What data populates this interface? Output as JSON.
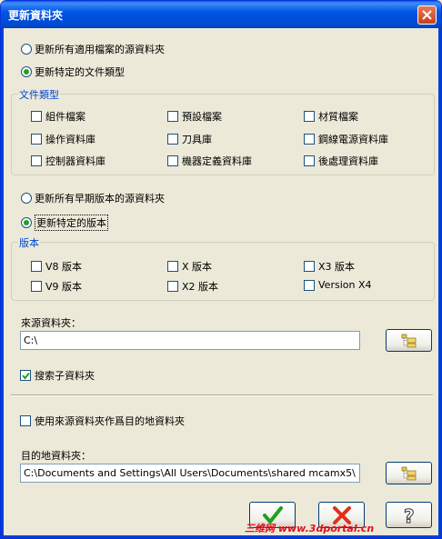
{
  "window": {
    "title": "更新資料夾"
  },
  "source_options": {
    "all_label": "更新所有適用檔案的源資料夾",
    "specific_label": "更新特定的文件類型",
    "selected": "specific"
  },
  "file_types": {
    "group_label": "文件類型",
    "items": [
      {
        "label": "組件檔案",
        "checked": false
      },
      {
        "label": "預設檔案",
        "checked": false
      },
      {
        "label": "材質檔案",
        "checked": false
      },
      {
        "label": "操作資料庫",
        "checked": false
      },
      {
        "label": "刀具庫",
        "checked": false
      },
      {
        "label": "鋼線電源資料庫",
        "checked": false
      },
      {
        "label": "控制器資料庫",
        "checked": false
      },
      {
        "label": "機器定義資料庫",
        "checked": false
      },
      {
        "label": "後處理資料庫",
        "checked": false
      }
    ]
  },
  "version_options": {
    "all_label": "更新所有早期版本的源資料夾",
    "specific_label": "更新特定的版本",
    "selected": "specific"
  },
  "versions": {
    "group_label": "版本",
    "items": [
      {
        "label": "V8 版本",
        "checked": false
      },
      {
        "label": "X 版本",
        "checked": false
      },
      {
        "label": "X3 版本",
        "checked": false
      },
      {
        "label": "V9 版本",
        "checked": false
      },
      {
        "label": "X2 版本",
        "checked": false
      },
      {
        "label": "Version X4",
        "checked": false
      }
    ]
  },
  "source_folder": {
    "label": "來源資料夾：",
    "value": "C:\\"
  },
  "search_subfolders": {
    "label": "搜索子資料夾",
    "checked": true
  },
  "use_source_as_dest": {
    "label": "使用來源資料夾作爲目的地資料夾",
    "checked": false
  },
  "destination_folder": {
    "label": "目的地資料夾：",
    "value": "C:\\Documents and Settings\\All Users\\Documents\\shared mcamx5\\"
  },
  "watermark": "三维网 www.3dportal.cn",
  "colors": {
    "title_bar": "#0055e5",
    "dialog_bg": "#ece9d8",
    "group_label": "#0046d5",
    "ok_green": "#1fa01f",
    "cancel_red": "#e0301a"
  }
}
